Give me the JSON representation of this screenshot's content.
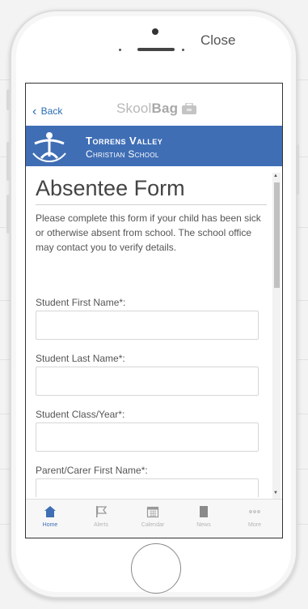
{
  "device": {
    "close_label": "Close"
  },
  "nav": {
    "back_label": "Back",
    "app_name_light": "Skool",
    "app_name_bold": "Bag"
  },
  "banner": {
    "line1": "Torrens Valley",
    "line2": "Christian School"
  },
  "form": {
    "title": "Absentee Form",
    "intro": "Please complete this form if your child has been sick or otherwise absent from school. The school office may contact you to verify details.",
    "fields": [
      {
        "label": "Student First Name*:",
        "value": ""
      },
      {
        "label": "Student Last Name*:",
        "value": ""
      },
      {
        "label": "Student Class/Year*:",
        "value": ""
      },
      {
        "label": "Parent/Carer First Name*:",
        "value": ""
      }
    ]
  },
  "tabs": [
    {
      "label": "Home",
      "icon": "home-icon",
      "active": true
    },
    {
      "label": "Alerts",
      "icon": "flag-icon",
      "active": false
    },
    {
      "label": "Calendar",
      "icon": "calendar-icon",
      "active": false
    },
    {
      "label": "News",
      "icon": "news-icon",
      "active": false
    },
    {
      "label": "More",
      "icon": "more-icon",
      "active": false
    }
  ],
  "colors": {
    "accent": "#3f6eb5",
    "link": "#2a6db3",
    "active_tab": "#3f6eb5",
    "inactive_tab": "#b5b5b5"
  }
}
